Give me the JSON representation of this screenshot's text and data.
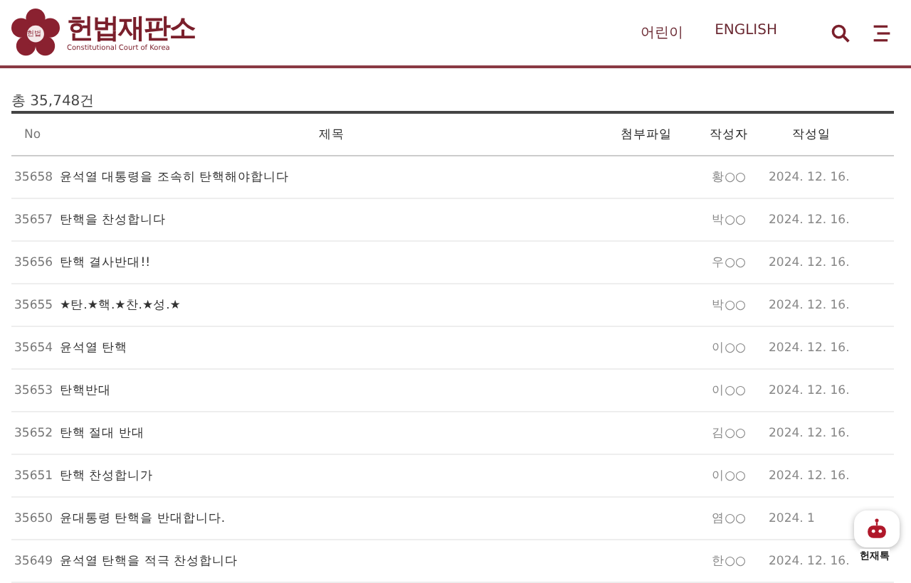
{
  "header": {
    "logo_title": "헌법재판소",
    "logo_subtitle": "Constitutional Court of Korea",
    "emblem_text": "헌법",
    "nav": [
      "어린이",
      "ENGLISH"
    ]
  },
  "total": "총 35,748건",
  "table": {
    "columns": [
      "No",
      "제목",
      "첨부파일",
      "작성자",
      "작성일"
    ],
    "rows": [
      {
        "no": "35658",
        "title": "윤석열 대통령을 조속히 탄핵해야합니다",
        "author": "황○○",
        "date": "2024. 12. 16."
      },
      {
        "no": "35657",
        "title": "탄핵을 찬성합니다",
        "author": "박○○",
        "date": "2024. 12. 16."
      },
      {
        "no": "35656",
        "title": "탄핵 결사반대!!",
        "author": "우○○",
        "date": "2024. 12. 16."
      },
      {
        "no": "35655",
        "title": "★탄.★핵.★찬.★성.★",
        "author": "박○○",
        "date": "2024. 12. 16."
      },
      {
        "no": "35654",
        "title": "윤석열 탄핵",
        "author": "이○○",
        "date": "2024. 12. 16."
      },
      {
        "no": "35653",
        "title": "탄핵반대",
        "author": "이○○",
        "date": "2024. 12. 16."
      },
      {
        "no": "35652",
        "title": "탄핵 절대 반대",
        "author": "김○○",
        "date": "2024. 12. 16."
      },
      {
        "no": "35651",
        "title": "탄핵 찬성합니가",
        "author": "이○○",
        "date": "2024. 12. 16."
      },
      {
        "no": "35650",
        "title": "윤대통령 탄핵을 반대합니다.",
        "author": "염○○",
        "date": "2024. 1"
      },
      {
        "no": "35649",
        "title": "윤석열 탄핵을 적극 찬성합니다",
        "author": "한○○",
        "date": "2024. 12. 16."
      }
    ]
  },
  "chatbot": {
    "label": "헌재톡"
  }
}
